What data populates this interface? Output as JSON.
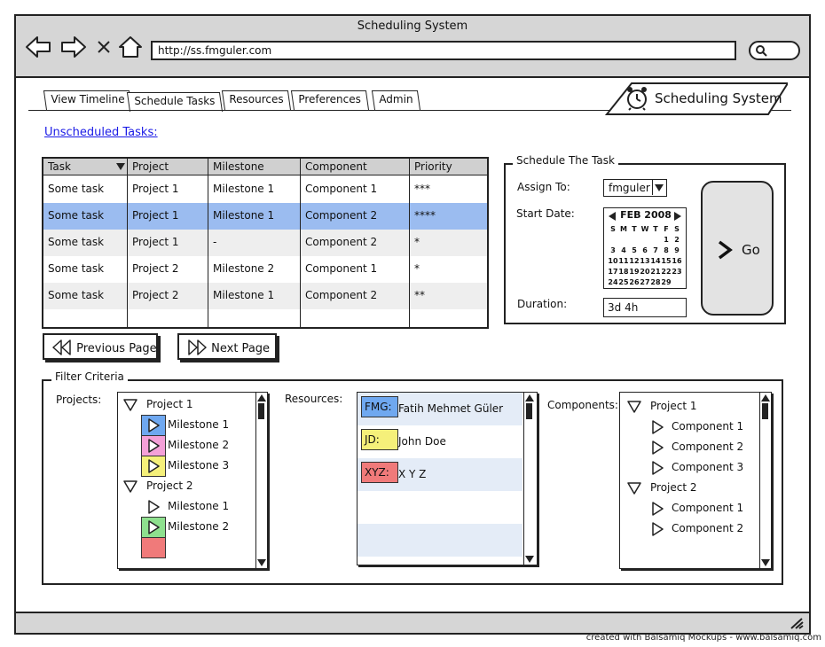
{
  "browser": {
    "title": "Scheduling System",
    "url": "http://ss.fmguler.com"
  },
  "tabs": [
    {
      "label": "View Timeline",
      "active": false
    },
    {
      "label": "Schedule Tasks",
      "active": true
    },
    {
      "label": "Resources",
      "active": false
    },
    {
      "label": "Preferences",
      "active": false
    },
    {
      "label": "Admin",
      "active": false
    }
  ],
  "app_logo": {
    "label": "Scheduling System",
    "icon": "alarm-clock-icon"
  },
  "unscheduled_link": "Unscheduled Tasks:",
  "task_table": {
    "columns": [
      "Task",
      "Project",
      "Milestone",
      "Component",
      "Priority"
    ],
    "sort_icon": "sort-down-icon",
    "rows": [
      {
        "task": "Some task",
        "project": "Project 1",
        "milestone": "Milestone 1",
        "component": "Component 1",
        "priority": "***",
        "selected": false
      },
      {
        "task": "Some task",
        "project": "Project 1",
        "milestone": "Milestone 1",
        "component": "Component 2",
        "priority": "****",
        "selected": true
      },
      {
        "task": "Some task",
        "project": "Project 1",
        "milestone": "-",
        "component": "Component 2",
        "priority": "*",
        "selected": false
      },
      {
        "task": "Some task",
        "project": "Project 2",
        "milestone": "Milestone 2",
        "component": "Component 1",
        "priority": "*",
        "selected": false
      },
      {
        "task": "Some task",
        "project": "Project 2",
        "milestone": "Milestone 1",
        "component": "Component 2",
        "priority": "**",
        "selected": false
      }
    ]
  },
  "pagination": {
    "previous": "Previous Page",
    "next": "Next Page"
  },
  "schedule_panel": {
    "legend": "Schedule The Task",
    "assign_label": "Assign To:",
    "assign_value": "fmguler",
    "start_label": "Start Date:",
    "duration_label": "Duration:",
    "duration_value": "3d 4h",
    "go_label": "Go",
    "calendar": {
      "month": "FEB 2008",
      "weekdays": [
        "S",
        "M",
        "T",
        "W",
        "T",
        "F",
        "S"
      ],
      "weeks": [
        [
          "",
          "",
          "",
          "",
          "",
          "1",
          "2"
        ],
        [
          "3",
          "4",
          "5",
          "6",
          "7",
          "8",
          "9"
        ],
        [
          "10",
          "11",
          "12",
          "13",
          "14",
          "15",
          "16"
        ],
        [
          "17",
          "18",
          "19",
          "20",
          "21",
          "22",
          "23"
        ],
        [
          "24",
          "25",
          "26",
          "27",
          "28",
          "29",
          ""
        ]
      ]
    }
  },
  "filter": {
    "legend": "Filter Criteria",
    "projects_label": "Projects:",
    "resources_label": "Resources:",
    "components_label": "Components:",
    "projects_tree": [
      {
        "label": "Project 1",
        "level": 0,
        "expanded": true
      },
      {
        "label": "Milestone 1",
        "level": 1,
        "color": "#6fa8f0"
      },
      {
        "label": "Milestone 2",
        "level": 1,
        "color": "#f4a0d8"
      },
      {
        "label": "Milestone 3",
        "level": 1,
        "color": "#f5f07a"
      },
      {
        "label": "Project 2",
        "level": 0,
        "expanded": true
      },
      {
        "label": "Milestone 1",
        "level": 1,
        "color": ""
      },
      {
        "label": "Milestone 2",
        "level": 1,
        "color": "#8ee08e"
      },
      {
        "label": "",
        "level": 1,
        "color": "#f07a7a"
      }
    ],
    "resources": [
      {
        "tag": "FMG:",
        "name": "Fatih Mehmet Güler",
        "color": "#6fa8f0"
      },
      {
        "tag": "JD:",
        "name": "John Doe",
        "color": "#f5f07a"
      },
      {
        "tag": "XYZ:",
        "name": "X Y Z",
        "color": "#f07a7a"
      }
    ],
    "components_tree": [
      {
        "label": "Project 1",
        "level": 0
      },
      {
        "label": "Component 1",
        "level": 1
      },
      {
        "label": "Component 2",
        "level": 1
      },
      {
        "label": "Component 3",
        "level": 1
      },
      {
        "label": "Project 2",
        "level": 0
      },
      {
        "label": "Component 1",
        "level": 1
      },
      {
        "label": "Component 2",
        "level": 1
      }
    ]
  },
  "credit": "created with Balsamiq Mockups - www.balsamiq.com"
}
